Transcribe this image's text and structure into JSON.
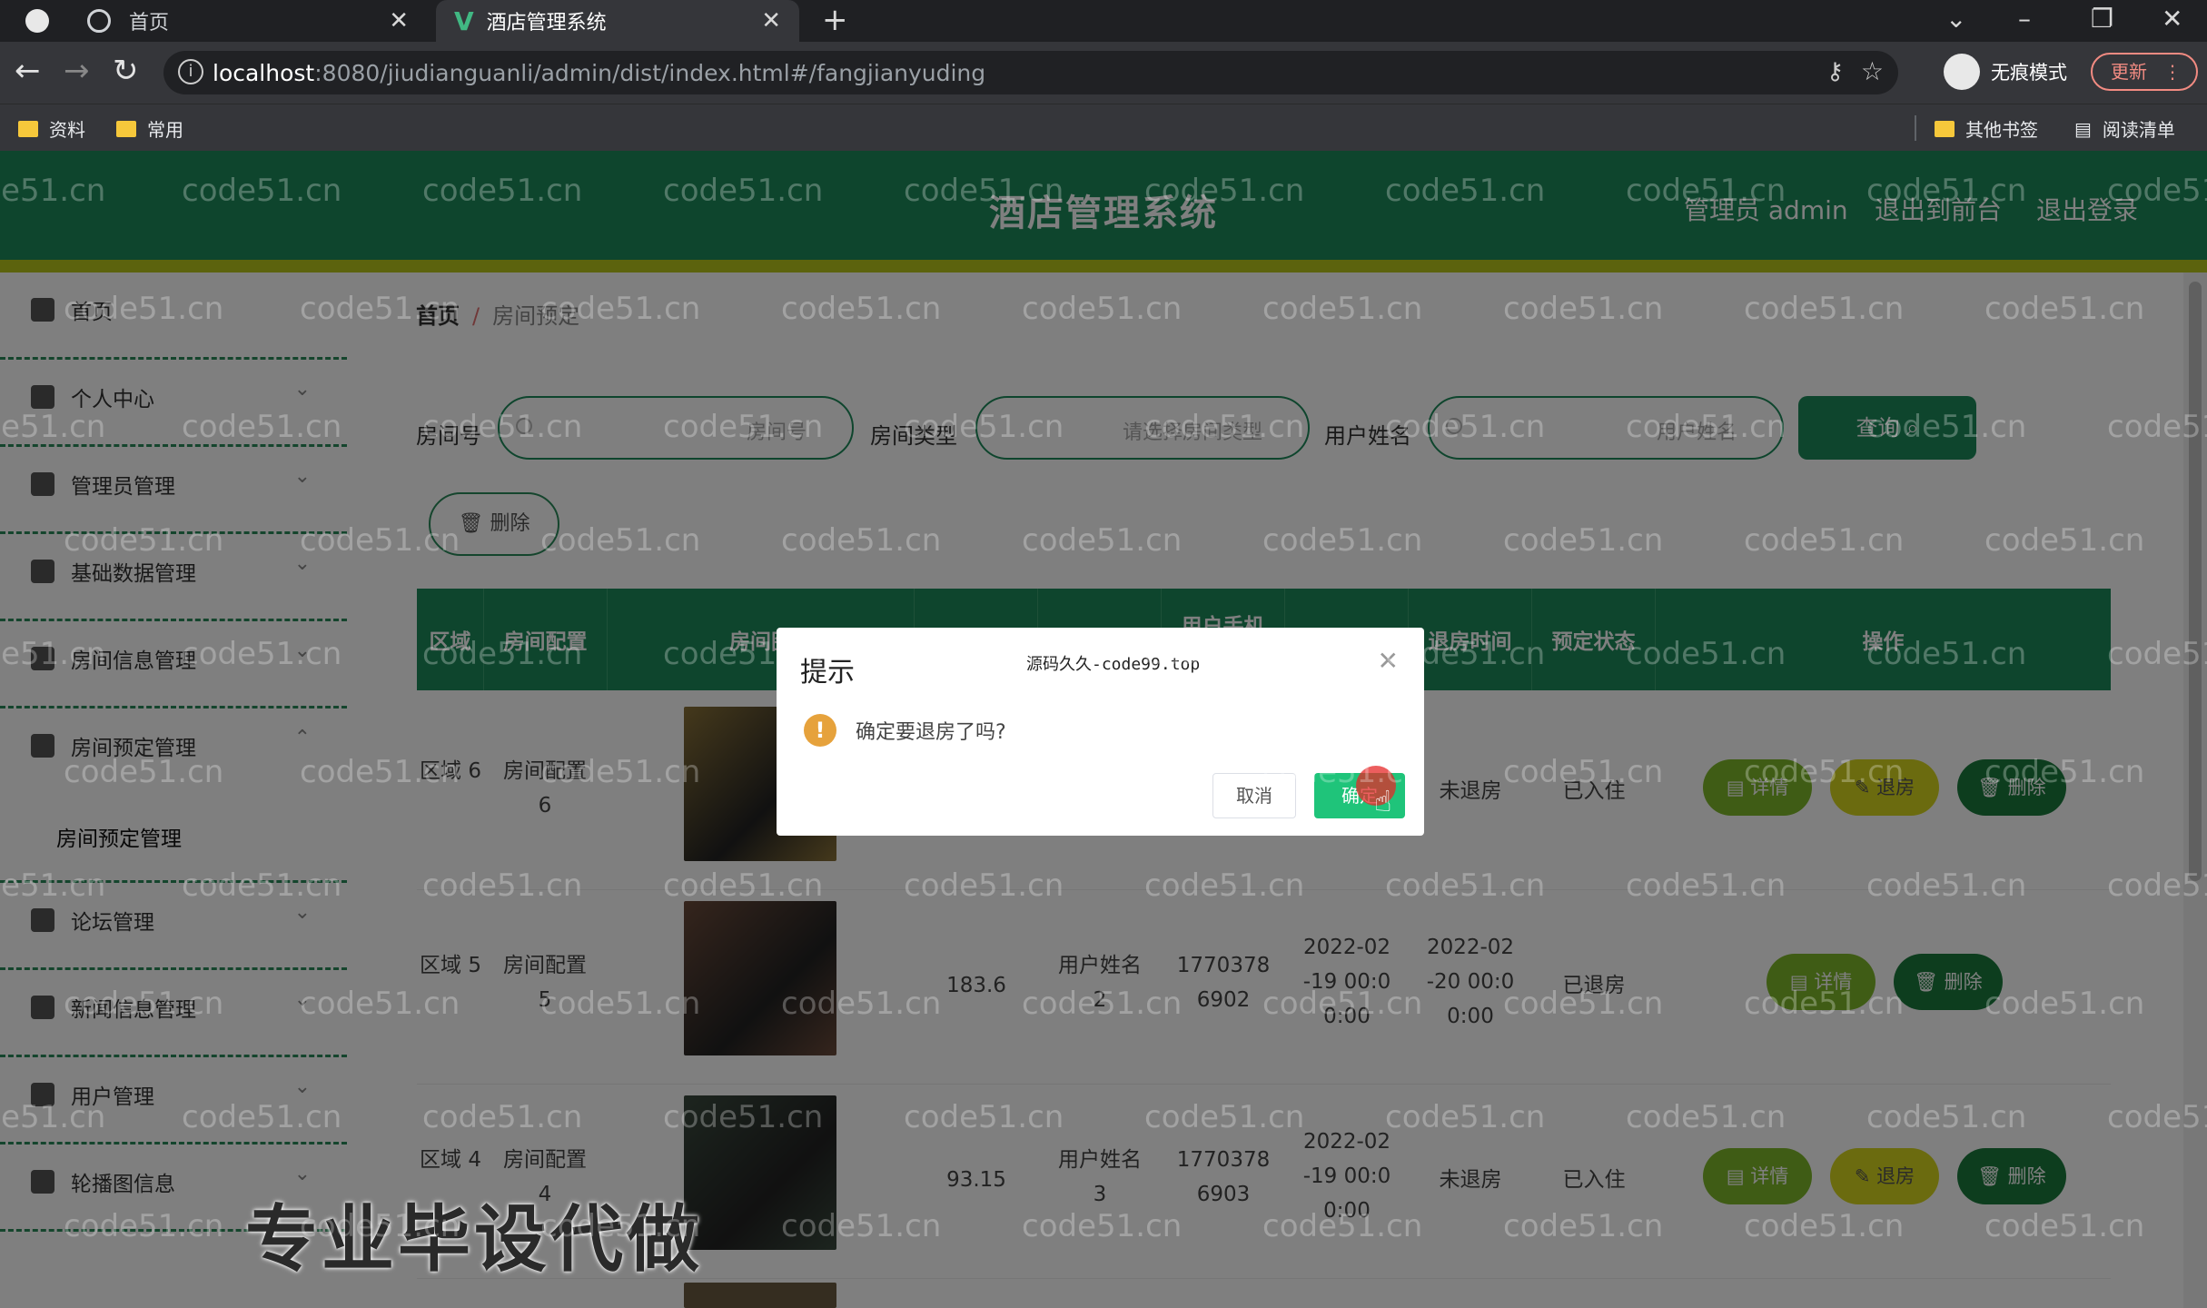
{
  "browser": {
    "tabs": [
      {
        "title": "首页"
      },
      {
        "title": "酒店管理系统"
      }
    ],
    "url_host": "localhost",
    "url_path": ":8080/jiudianguanli/admin/dist/index.html#/fangjianyuding",
    "incognito_label": "无痕模式",
    "update_label": "更新",
    "bookmarks": [
      "资料",
      "常用"
    ],
    "bookmarks_right": [
      "其他书签",
      "阅读清单"
    ]
  },
  "app": {
    "title": "酒店管理系统",
    "header_links": [
      "管理员 admin",
      "退出到前台",
      "退出登录"
    ]
  },
  "sidebar": {
    "items": [
      {
        "label": "首页",
        "icon": "home-icon"
      },
      {
        "label": "个人中心",
        "icon": "user-icon"
      },
      {
        "label": "管理员管理",
        "icon": "send-icon"
      },
      {
        "label": "基础数据管理",
        "icon": "copy-icon"
      },
      {
        "label": "房间信息管理",
        "icon": "clock-icon"
      },
      {
        "label": "房间预定管理",
        "icon": "pin-icon"
      },
      {
        "label": "论坛管理",
        "icon": "send-icon"
      },
      {
        "label": "新闻信息管理",
        "icon": "user-icon"
      },
      {
        "label": "用户管理",
        "icon": "table-icon"
      },
      {
        "label": "轮播图信息",
        "icon": "menu-icon"
      }
    ],
    "sub_item": "房间预定管理"
  },
  "breadcrumb": {
    "home": "首页",
    "sep": "/",
    "current": "房间预定"
  },
  "filters": {
    "room_no_label": "房间号",
    "room_no_placeholder": "房间号",
    "room_type_label": "房间类型",
    "room_type_placeholder": "请选择房间类型",
    "user_name_label": "用户姓名",
    "user_name_placeholder": "用户姓名",
    "query_label": "查询"
  },
  "bulk_delete_label": "删除",
  "table": {
    "headers": [
      "区域",
      "房间配置",
      "房间图",
      "",
      "",
      "用户手机",
      "",
      "退房时间",
      "预定状态",
      "操作"
    ],
    "rows": [
      {
        "area": "区域 6",
        "config": "房间配置 6",
        "price": "",
        "user": "",
        "phone": "",
        "in_time": "",
        "out_time": "未退房",
        "status": "已入住",
        "actions": [
          "详情",
          "退房",
          "删除"
        ],
        "thumb_color": "#8a7238"
      },
      {
        "area": "区域 5",
        "config": "房间配置 5",
        "price": "183.6",
        "user": "用户姓名 2",
        "phone": "17703786902",
        "in_time": "2022-02-19 00:00:00",
        "out_time": "2022-02-20 00:00:00",
        "status": "已退房",
        "actions": [
          "详情",
          "删除"
        ],
        "thumb_color": "#6a4a3a"
      },
      {
        "area": "区域 4",
        "config": "房间配置 4",
        "price": "93.15",
        "user": "用户姓名 3",
        "phone": "17703786903",
        "in_time": "2022-02-19 00:00:00",
        "out_time": "未退房",
        "status": "已入住",
        "actions": [
          "详情",
          "退房",
          "删除"
        ],
        "thumb_color": "#3a4a3e"
      }
    ]
  },
  "dialog": {
    "title": "提示",
    "source_text": "源码久久-code99.top",
    "message": "确定要退房了吗?",
    "cancel_label": "取消",
    "ok_label": "确定"
  },
  "watermark": "code51.cn",
  "promo_text": "专业毕设代做"
}
